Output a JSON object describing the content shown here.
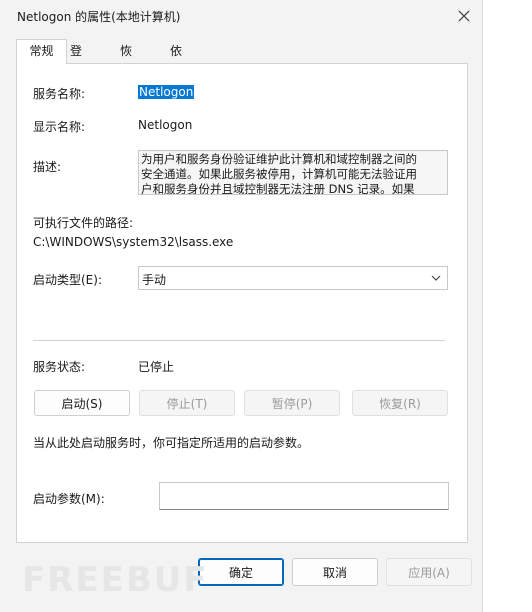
{
  "window": {
    "title": "Netlogon 的属性(本地计算机)"
  },
  "tabs": [
    {
      "label": "常规",
      "active": true
    },
    {
      "label": "登录",
      "active": false
    },
    {
      "label": "恢复",
      "active": false
    },
    {
      "label": "依存关系",
      "active": false
    }
  ],
  "general": {
    "service_name_label": "服务名称:",
    "service_name_value": "Netlogon",
    "display_name_label": "显示名称:",
    "display_name_value": "Netlogon",
    "description_label": "描述:",
    "description_lines": [
      "为用户和服务身份验证维护此计算机和域控制器之间的",
      "安全通道。如果此服务被停用，计算机可能无法验证用",
      "户和服务身份并且域控制器无法注册 DNS 记录。如果"
    ],
    "path_label": "可执行文件的路径:",
    "path_value": "C:\\WINDOWS\\system32\\lsass.exe",
    "startup_type_label": "启动类型(E):",
    "startup_type_value": "手动",
    "status_label": "服务状态:",
    "status_value": "已停止",
    "start_button": "启动(S)",
    "stop_button": "停止(T)",
    "pause_button": "暂停(P)",
    "resume_button": "恢复(R)",
    "hint_text": "当从此处启动服务时，你可指定所适用的启动参数。",
    "start_params_label": "启动参数(M):",
    "start_params_value": ""
  },
  "footer": {
    "ok_button": "确定",
    "cancel_button": "取消",
    "apply_button": "应用(A)"
  },
  "watermark": {
    "text": "FREEBUF"
  }
}
